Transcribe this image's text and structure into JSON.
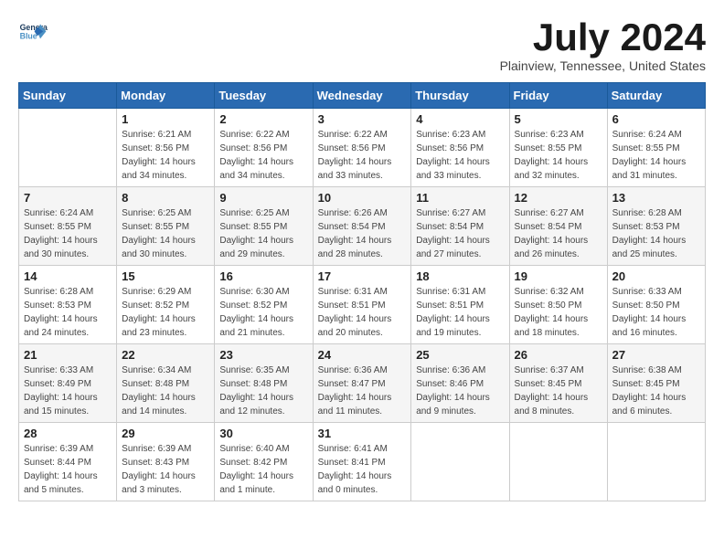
{
  "header": {
    "logo_general": "General",
    "logo_blue": "Blue",
    "month_title": "July 2024",
    "location": "Plainview, Tennessee, United States"
  },
  "days_of_week": [
    "Sunday",
    "Monday",
    "Tuesday",
    "Wednesday",
    "Thursday",
    "Friday",
    "Saturday"
  ],
  "weeks": [
    [
      {
        "day": "",
        "info": ""
      },
      {
        "day": "1",
        "info": "Sunrise: 6:21 AM\nSunset: 8:56 PM\nDaylight: 14 hours\nand 34 minutes."
      },
      {
        "day": "2",
        "info": "Sunrise: 6:22 AM\nSunset: 8:56 PM\nDaylight: 14 hours\nand 34 minutes."
      },
      {
        "day": "3",
        "info": "Sunrise: 6:22 AM\nSunset: 8:56 PM\nDaylight: 14 hours\nand 33 minutes."
      },
      {
        "day": "4",
        "info": "Sunrise: 6:23 AM\nSunset: 8:56 PM\nDaylight: 14 hours\nand 33 minutes."
      },
      {
        "day": "5",
        "info": "Sunrise: 6:23 AM\nSunset: 8:55 PM\nDaylight: 14 hours\nand 32 minutes."
      },
      {
        "day": "6",
        "info": "Sunrise: 6:24 AM\nSunset: 8:55 PM\nDaylight: 14 hours\nand 31 minutes."
      }
    ],
    [
      {
        "day": "7",
        "info": "Sunrise: 6:24 AM\nSunset: 8:55 PM\nDaylight: 14 hours\nand 30 minutes."
      },
      {
        "day": "8",
        "info": "Sunrise: 6:25 AM\nSunset: 8:55 PM\nDaylight: 14 hours\nand 30 minutes."
      },
      {
        "day": "9",
        "info": "Sunrise: 6:25 AM\nSunset: 8:55 PM\nDaylight: 14 hours\nand 29 minutes."
      },
      {
        "day": "10",
        "info": "Sunrise: 6:26 AM\nSunset: 8:54 PM\nDaylight: 14 hours\nand 28 minutes."
      },
      {
        "day": "11",
        "info": "Sunrise: 6:27 AM\nSunset: 8:54 PM\nDaylight: 14 hours\nand 27 minutes."
      },
      {
        "day": "12",
        "info": "Sunrise: 6:27 AM\nSunset: 8:54 PM\nDaylight: 14 hours\nand 26 minutes."
      },
      {
        "day": "13",
        "info": "Sunrise: 6:28 AM\nSunset: 8:53 PM\nDaylight: 14 hours\nand 25 minutes."
      }
    ],
    [
      {
        "day": "14",
        "info": "Sunrise: 6:28 AM\nSunset: 8:53 PM\nDaylight: 14 hours\nand 24 minutes."
      },
      {
        "day": "15",
        "info": "Sunrise: 6:29 AM\nSunset: 8:52 PM\nDaylight: 14 hours\nand 23 minutes."
      },
      {
        "day": "16",
        "info": "Sunrise: 6:30 AM\nSunset: 8:52 PM\nDaylight: 14 hours\nand 21 minutes."
      },
      {
        "day": "17",
        "info": "Sunrise: 6:31 AM\nSunset: 8:51 PM\nDaylight: 14 hours\nand 20 minutes."
      },
      {
        "day": "18",
        "info": "Sunrise: 6:31 AM\nSunset: 8:51 PM\nDaylight: 14 hours\nand 19 minutes."
      },
      {
        "day": "19",
        "info": "Sunrise: 6:32 AM\nSunset: 8:50 PM\nDaylight: 14 hours\nand 18 minutes."
      },
      {
        "day": "20",
        "info": "Sunrise: 6:33 AM\nSunset: 8:50 PM\nDaylight: 14 hours\nand 16 minutes."
      }
    ],
    [
      {
        "day": "21",
        "info": "Sunrise: 6:33 AM\nSunset: 8:49 PM\nDaylight: 14 hours\nand 15 minutes."
      },
      {
        "day": "22",
        "info": "Sunrise: 6:34 AM\nSunset: 8:48 PM\nDaylight: 14 hours\nand 14 minutes."
      },
      {
        "day": "23",
        "info": "Sunrise: 6:35 AM\nSunset: 8:48 PM\nDaylight: 14 hours\nand 12 minutes."
      },
      {
        "day": "24",
        "info": "Sunrise: 6:36 AM\nSunset: 8:47 PM\nDaylight: 14 hours\nand 11 minutes."
      },
      {
        "day": "25",
        "info": "Sunrise: 6:36 AM\nSunset: 8:46 PM\nDaylight: 14 hours\nand 9 minutes."
      },
      {
        "day": "26",
        "info": "Sunrise: 6:37 AM\nSunset: 8:45 PM\nDaylight: 14 hours\nand 8 minutes."
      },
      {
        "day": "27",
        "info": "Sunrise: 6:38 AM\nSunset: 8:45 PM\nDaylight: 14 hours\nand 6 minutes."
      }
    ],
    [
      {
        "day": "28",
        "info": "Sunrise: 6:39 AM\nSunset: 8:44 PM\nDaylight: 14 hours\nand 5 minutes."
      },
      {
        "day": "29",
        "info": "Sunrise: 6:39 AM\nSunset: 8:43 PM\nDaylight: 14 hours\nand 3 minutes."
      },
      {
        "day": "30",
        "info": "Sunrise: 6:40 AM\nSunset: 8:42 PM\nDaylight: 14 hours\nand 1 minute."
      },
      {
        "day": "31",
        "info": "Sunrise: 6:41 AM\nSunset: 8:41 PM\nDaylight: 14 hours\nand 0 minutes."
      },
      {
        "day": "",
        "info": ""
      },
      {
        "day": "",
        "info": ""
      },
      {
        "day": "",
        "info": ""
      }
    ]
  ]
}
